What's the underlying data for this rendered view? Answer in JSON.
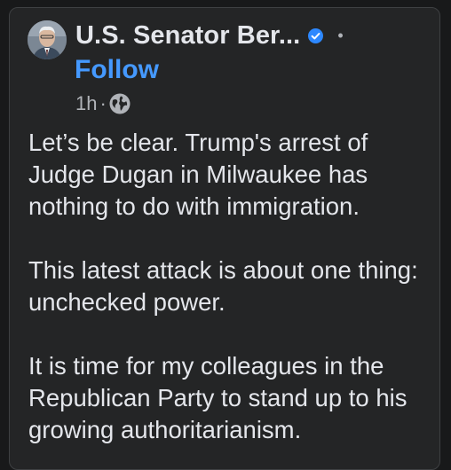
{
  "post": {
    "author": "U.S. Senator Ber...",
    "follow_label": "Follow",
    "time": "1h",
    "time_separator": "·",
    "header_separator": "•",
    "verified_icon": "verified-badge-icon",
    "audience_icon": "globe-icon",
    "paragraphs": [
      "Let’s be clear. Trump's arrest of Judge Dugan in Milwaukee has nothing to do with immigration.",
      "This latest attack is about one thing: unchecked power.",
      "It is time for my colleagues in the Republican Party to stand up to his growing authoritarianism."
    ]
  },
  "colors": {
    "background": "#18191a",
    "card": "#242526",
    "text": "#e4e6eb",
    "secondary_text": "#b0b3b8",
    "link": "#4599ff",
    "verified": "#2d88ff"
  }
}
